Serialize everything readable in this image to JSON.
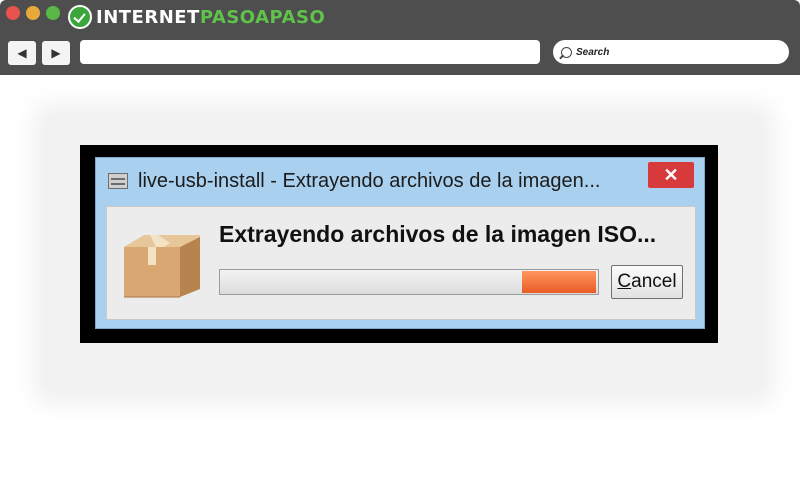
{
  "browser": {
    "brand_part1": "INTERNET",
    "brand_part2": "PASOAPASO",
    "nav_back_icon": "◀",
    "nav_forward_icon": "▶",
    "url_value": "",
    "search_placeholder": "Search"
  },
  "dialog": {
    "window_title": "live-usb-install - Extrayendo archivos de la imagen...",
    "close_glyph": "✕",
    "heading": "Extrayendo archivos de la imagen ISO...",
    "progress": {
      "chunk_start": 0.8,
      "chunk_end": 0.995
    },
    "cancel_mnemonic": "C",
    "cancel_rest": "ancel"
  },
  "colors": {
    "chrome_bg": "#4e4e4e",
    "brand_green": "#5fc24a",
    "dialog_frame": "#a9d0ee",
    "close_red": "#d63a3a",
    "progress_orange": "#ea5b24"
  },
  "icons": [
    "box-icon",
    "search-icon",
    "app-window-icon",
    "close-icon"
  ]
}
